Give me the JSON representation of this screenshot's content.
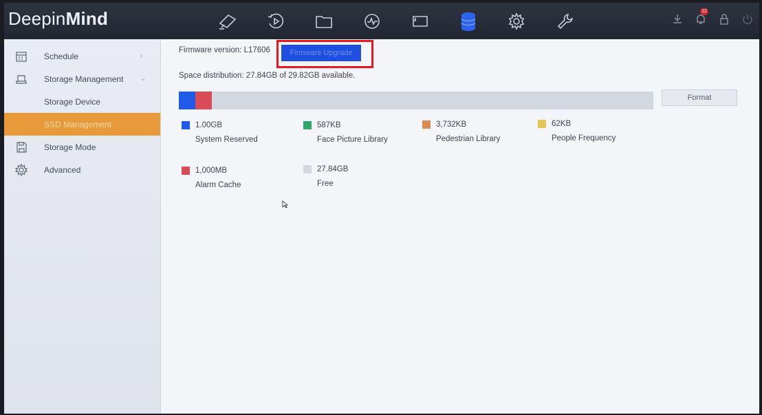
{
  "app": {
    "logo_prefix": "Deepin",
    "logo_bold": "Mind"
  },
  "topnav": {
    "icons": [
      {
        "name": "live-view-camera-icon",
        "active": false
      },
      {
        "name": "playback-icon",
        "active": false
      },
      {
        "name": "file-folder-icon",
        "active": false
      },
      {
        "name": "smart-analysis-icon",
        "active": false
      },
      {
        "name": "configuration-screen-icon",
        "active": false
      },
      {
        "name": "storage-database-icon",
        "active": true
      },
      {
        "name": "settings-gear-icon",
        "active": false
      },
      {
        "name": "maintenance-wrench-icon",
        "active": false
      }
    ],
    "right": {
      "download_icon": "download-icon",
      "alarm_icon": "alarm-bell-icon",
      "alarm_badge": "12",
      "lock_icon": "lock-icon",
      "power_icon": "power-icon"
    }
  },
  "sidebar": {
    "items": [
      {
        "label": "Schedule",
        "icon": "calendar-icon",
        "chevron": "›"
      },
      {
        "label": "Storage Management",
        "icon": "hdd-icon",
        "chevron": "⌄"
      },
      {
        "label": "Storage Device",
        "sub": true
      },
      {
        "label": "SSD Management",
        "sub": true,
        "selected": true
      },
      {
        "label": "Storage Mode",
        "icon": "save-disk-icon"
      },
      {
        "label": "Advanced",
        "icon": "gear-icon"
      }
    ]
  },
  "main": {
    "firmware_label": "Firmware version: L17606",
    "firmware_button": "Firmware Upgrade",
    "space_text": "Space distribution: 27.84GB of 29.82GB available.",
    "format_button": "Format",
    "legend": [
      {
        "value": "1.00GB",
        "name": "System Reserved",
        "color": "#1f5be8"
      },
      {
        "value": "587KB",
        "name": "Face Picture Library",
        "color": "#2fa66a"
      },
      {
        "value": "3,732KB",
        "name": "Pedestrian Library",
        "color": "#d98b55"
      },
      {
        "value": "62KB",
        "name": "People Frequency",
        "color": "#e6c45a"
      },
      {
        "value": "1,000MB",
        "name": "Alarm Cache",
        "color": "#d94b57"
      },
      {
        "value": "27.84GB",
        "name": "Free",
        "color": "#d3d8e0"
      }
    ]
  }
}
